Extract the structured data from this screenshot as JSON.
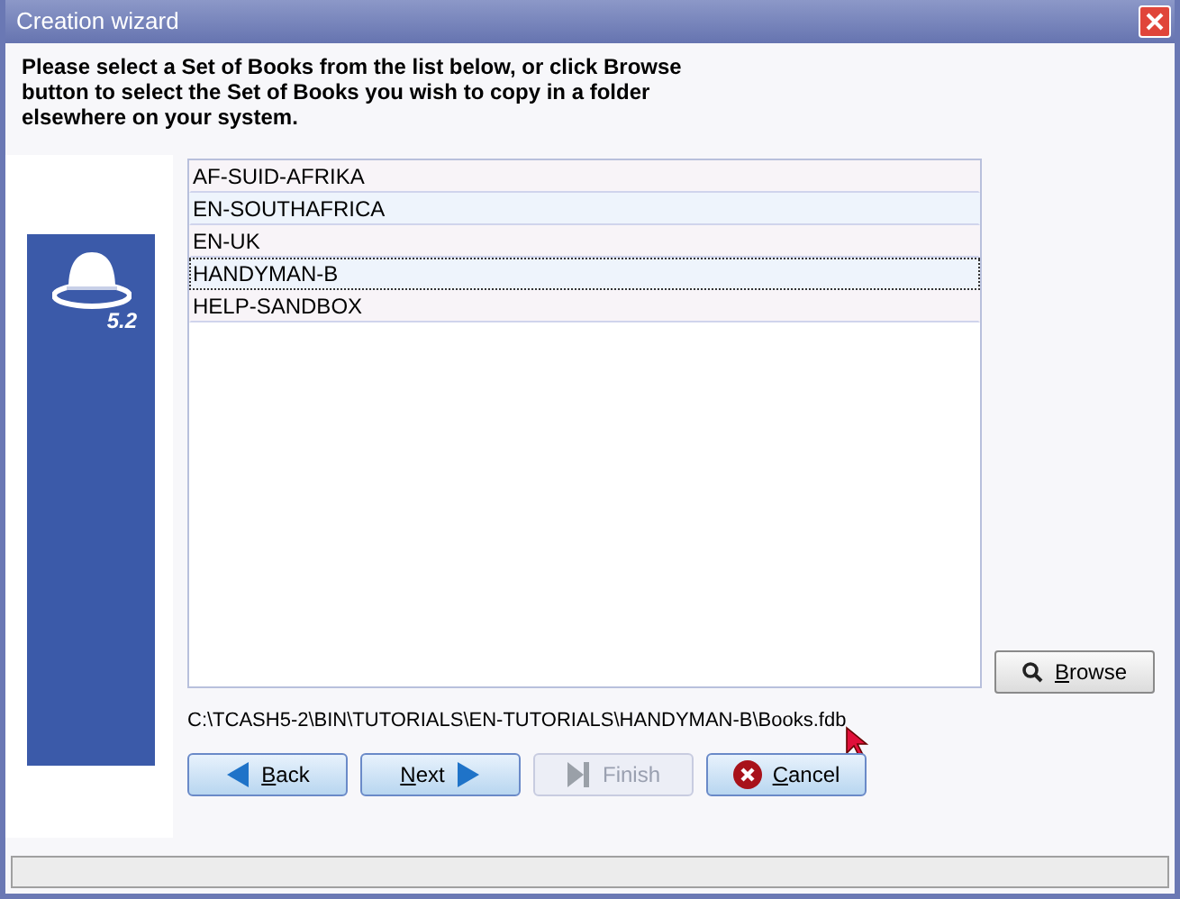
{
  "window": {
    "title": "Creation wizard"
  },
  "instructions": "Please select a Set of Books from the list below, or click Browse button to select the Set of Books you wish to copy in a folder elsewhere on your system.",
  "logo": {
    "version": "5.2"
  },
  "books": [
    {
      "name": "AF-SUID-AFRIKA",
      "selected": false
    },
    {
      "name": "EN-SOUTHAFRICA",
      "selected": false
    },
    {
      "name": "EN-UK",
      "selected": false
    },
    {
      "name": "HANDYMAN-B",
      "selected": true
    },
    {
      "name": "HELP-SANDBOX",
      "selected": false
    }
  ],
  "browse_button": {
    "label": "Browse",
    "mnemonic": true
  },
  "path": "C:\\TCASH5-2\\BIN\\TUTORIALS\\EN-TUTORIALS\\HANDYMAN-B\\Books.fdb",
  "buttons": [
    {
      "kind": "back",
      "label": "Back",
      "mnemonic": true,
      "disabled": false
    },
    {
      "kind": "next",
      "label": "Next",
      "mnemonic": true,
      "disabled": false
    },
    {
      "kind": "finish",
      "label": "Finish",
      "mnemonic": false,
      "disabled": true
    },
    {
      "kind": "cancel",
      "label": "Cancel",
      "mnemonic": true,
      "disabled": false
    }
  ]
}
